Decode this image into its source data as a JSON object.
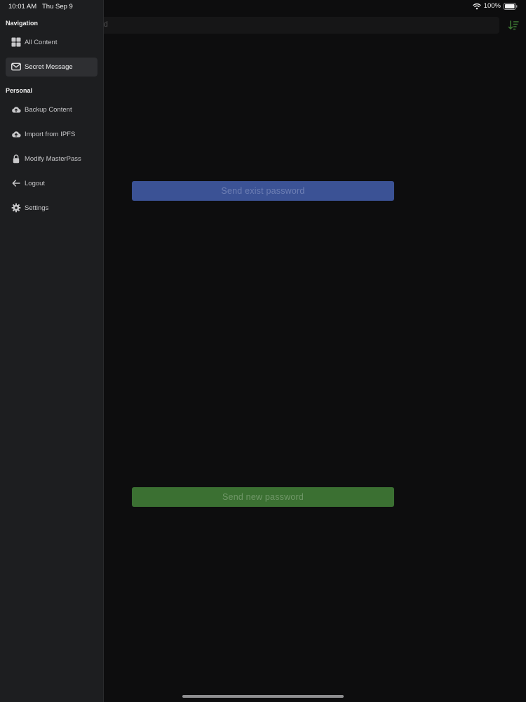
{
  "status_bar": {
    "time": "10:01 AM",
    "date": "Thu Sep 9",
    "battery": "100%",
    "wifi_icon": "wifi-icon",
    "battery_icon": "battery-icon"
  },
  "sidebar": {
    "sections": [
      {
        "header": "Navigation",
        "items": [
          {
            "label": "All Content",
            "icon": "grid-icon",
            "selected": false
          },
          {
            "label": "Secret Message",
            "icon": "envelope-icon",
            "selected": true
          }
        ]
      },
      {
        "header": "Personal",
        "items": [
          {
            "label": "Backup Content",
            "icon": "cloud-upload-icon",
            "selected": false
          },
          {
            "label": "Import from IPFS",
            "icon": "cloud-upload-icon",
            "selected": false
          },
          {
            "label": "Modify MasterPass",
            "icon": "lock-icon",
            "selected": false
          },
          {
            "label": "Logout",
            "icon": "arrow-left-icon",
            "selected": false
          },
          {
            "label": "Settings",
            "icon": "gear-icon",
            "selected": false
          }
        ]
      }
    ]
  },
  "main": {
    "search": {
      "placeholder_visible": "word"
    },
    "sort_icon": "sort-icon",
    "send_exist_label": "Send exist password",
    "send_new_label": "Send new password"
  },
  "colors": {
    "sidebar_bg": "#1d1e20",
    "main_bg": "#0d0d0e",
    "exist_button": "#3b5295",
    "new_button": "#3b7032",
    "sort_icon": "#3e7a34"
  }
}
